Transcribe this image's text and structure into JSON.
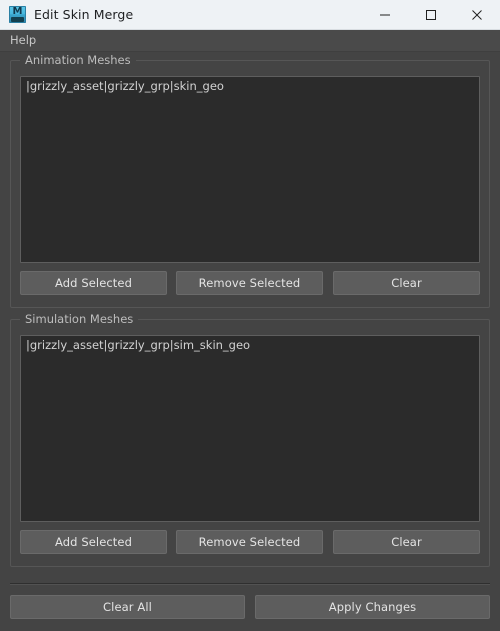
{
  "window": {
    "title": "Edit Skin Merge",
    "icon": "maya-app-icon",
    "controls": {
      "minimize": "minimize-icon",
      "maximize": "maximize-icon",
      "close": "close-icon"
    }
  },
  "menubar": {
    "items": [
      {
        "label": "Help"
      }
    ]
  },
  "colors": {
    "window_bg": "#444444",
    "titlebar_bg": "#eef2f5",
    "menubar_bg": "#4a4a4a",
    "listbox_bg": "#2b2b2b",
    "button_bg": "#5d5d5d",
    "text": "#e4e4e4",
    "group_border": "#565656"
  },
  "groups": [
    {
      "title": "Animation Meshes",
      "list": {
        "items": [
          "|grizzly_asset|grizzly_grp|skin_geo"
        ]
      },
      "buttons": {
        "add": "Add Selected",
        "remove": "Remove Selected",
        "clear": "Clear"
      }
    },
    {
      "title": "Simulation Meshes",
      "list": {
        "items": [
          "|grizzly_asset|grizzly_grp|sim_skin_geo"
        ]
      },
      "buttons": {
        "add": "Add Selected",
        "remove": "Remove Selected",
        "clear": "Clear"
      }
    }
  ],
  "footer": {
    "clear_all": "Clear All",
    "apply_changes": "Apply Changes"
  }
}
